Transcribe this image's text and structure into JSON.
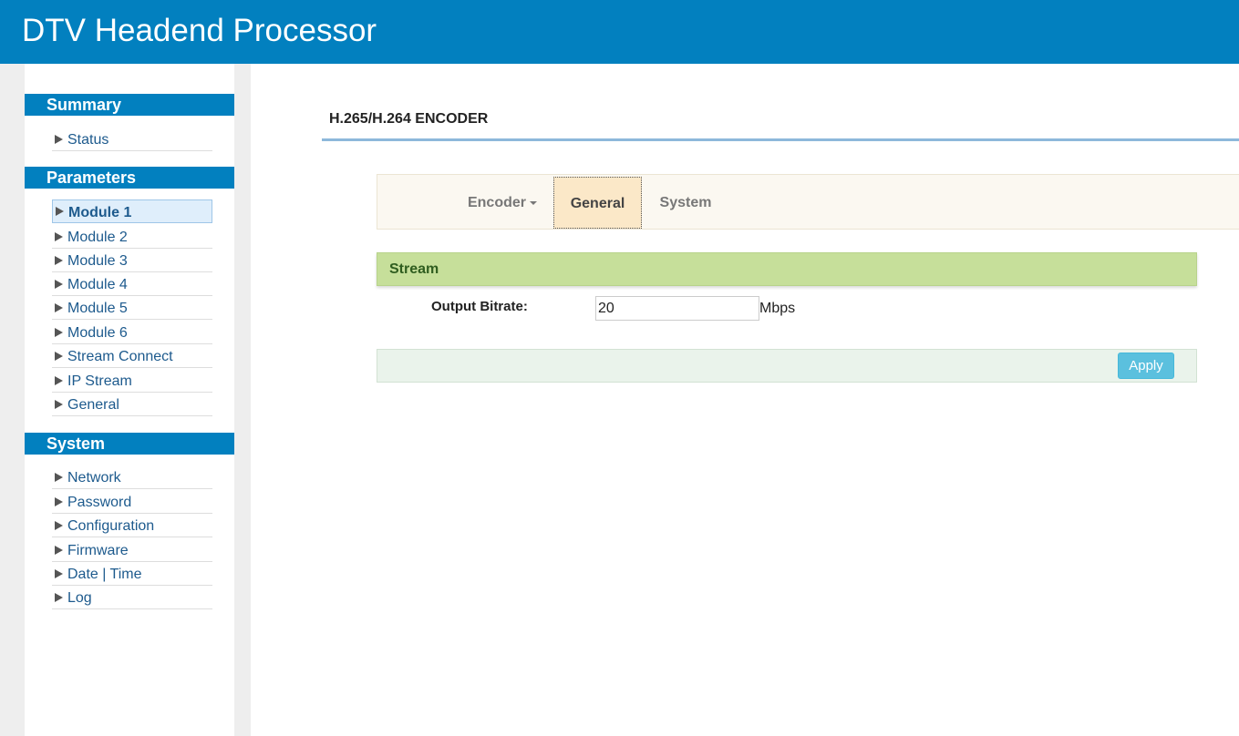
{
  "header": {
    "title": "DTV Headend Processor"
  },
  "sidebar": {
    "summary": {
      "heading": "Summary",
      "items": [
        {
          "label": "Status"
        }
      ]
    },
    "parameters": {
      "heading": "Parameters",
      "items": [
        {
          "label": "Module 1",
          "active": true
        },
        {
          "label": "Module 2"
        },
        {
          "label": "Module 3"
        },
        {
          "label": "Module 4"
        },
        {
          "label": "Module 5"
        },
        {
          "label": "Module 6"
        },
        {
          "label": "Stream Connect"
        },
        {
          "label": "IP Stream"
        },
        {
          "label": "General"
        }
      ]
    },
    "system": {
      "heading": "System",
      "items": [
        {
          "label": "Network"
        },
        {
          "label": "Password"
        },
        {
          "label": "Configuration"
        },
        {
          "label": "Firmware"
        },
        {
          "label": "Date | Time"
        },
        {
          "label": "Log"
        }
      ]
    }
  },
  "main": {
    "page_title": "H.265/H.264 ENCODER",
    "tabs": [
      {
        "label": "Encoder",
        "has_dropdown": true
      },
      {
        "label": "General",
        "active": true
      },
      {
        "label": "System"
      }
    ],
    "stream_panel": {
      "heading": "Stream",
      "output_bitrate_label": "Output Bitrate:",
      "output_bitrate_value": "20",
      "output_bitrate_unit": "Mbps"
    },
    "apply_label": "Apply"
  },
  "colors": {
    "header": "#0280bf",
    "panel_head": "#c6df9a",
    "apply": "#5bc0de",
    "active_tab": "#fbe8c8"
  }
}
